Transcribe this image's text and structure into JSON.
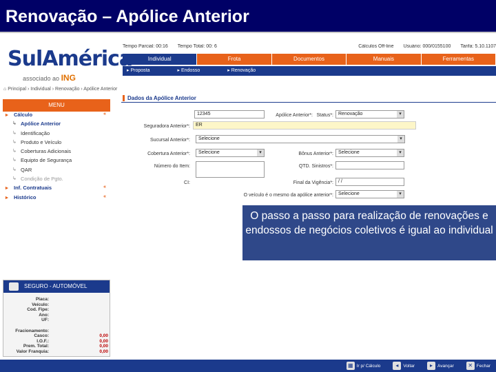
{
  "slide_title": "Renovação – Apólice Anterior",
  "logo": {
    "brand": "SulAmérica",
    "associated": "associado ao",
    "partner": "ING"
  },
  "topbar": {
    "tempo_parcial": "Tempo Parcial: 00:16",
    "tempo_total": "Tempo Total: 00: 6",
    "calculos": "Cálculos Off-line",
    "usuario": "Usuário: 000/0155100",
    "tarifa": "Tarifa: 5.10.1107"
  },
  "tabs": [
    "Individual",
    "Frota",
    "Documentos",
    "Manuais",
    "Ferramentas"
  ],
  "subtabs": [
    "Proposta",
    "Endosso",
    "Renovação"
  ],
  "breadcrumb": "Principal › Individual › Renovação › Apólice Anterior",
  "menu": {
    "header": "MENU",
    "items": [
      {
        "label": "Cálculo",
        "type": "bold",
        "caret": "«"
      },
      {
        "label": "Apólice Anterior",
        "type": "sub-active"
      },
      {
        "label": "Identificação",
        "type": "sub"
      },
      {
        "label": "Produto e Veículo",
        "type": "sub"
      },
      {
        "label": "Coberturas Adicionais",
        "type": "sub"
      },
      {
        "label": "Equipto de Segurança",
        "type": "sub"
      },
      {
        "label": "QAR",
        "type": "sub"
      },
      {
        "label": "Condição de Pgto.",
        "type": "sub-faded"
      },
      {
        "label": "Inf. Contratuais",
        "type": "bold",
        "caret": "«"
      },
      {
        "label": "Histórico",
        "type": "bold",
        "caret": "«"
      }
    ]
  },
  "auto_box": {
    "header": "SEGURO - AUTOMÓVEL",
    "fields_top": [
      "Placa:",
      "Veículo:",
      "Cod. Fipe:",
      "Ano:",
      "UF:"
    ],
    "fields_bottom": [
      {
        "k": "Fracionamento:",
        "v": ""
      },
      {
        "k": "Casco:",
        "v": "0,00"
      },
      {
        "k": "I.O.F.:",
        "v": "0,00"
      },
      {
        "k": "Prem. Total:",
        "v": "0,00"
      },
      {
        "k": "Valor Franquia:",
        "v": "0,00"
      }
    ]
  },
  "form": {
    "section_title": "Dados da Apólice Anterior",
    "apolice_label": "Apólice Anterior*:",
    "apolice_value": "12345",
    "status_label": "Status*:",
    "status_value": "Renovação",
    "seguradora_label": "Seguradora Anterior*:",
    "seguradora_value": "ER",
    "sucursal_label": "Sucursal Anterior*:",
    "sucursal_value": "Selecione",
    "cobertura_label": "Cobertura Anterior*:",
    "cobertura_value": "Selecione",
    "bonus_label": "Bônus Anterior*:",
    "bonus_value": "Selecione",
    "numero_item_label": "Número do Item:",
    "qtd_label": "QTD. Sinistros*:",
    "cic_label": "CI:",
    "final_vig_label": "Final da Vigência*:",
    "final_vig_value": "/ /",
    "veiculo_q_label": "O veículo é o mesmo da apólice anterior*:",
    "veiculo_q_value": "Selecione"
  },
  "callout": "O passo a passo para realização de renovações  e endossos de negócios coletivos é igual ao individual",
  "bottom_buttons": [
    "Ir p/ Cálculo",
    "Voltar",
    "Avançar",
    "Fechar"
  ],
  "colors": {
    "navy": "#1b3a8c",
    "orange": "#e8621a",
    "title_bg": "#000066"
  }
}
